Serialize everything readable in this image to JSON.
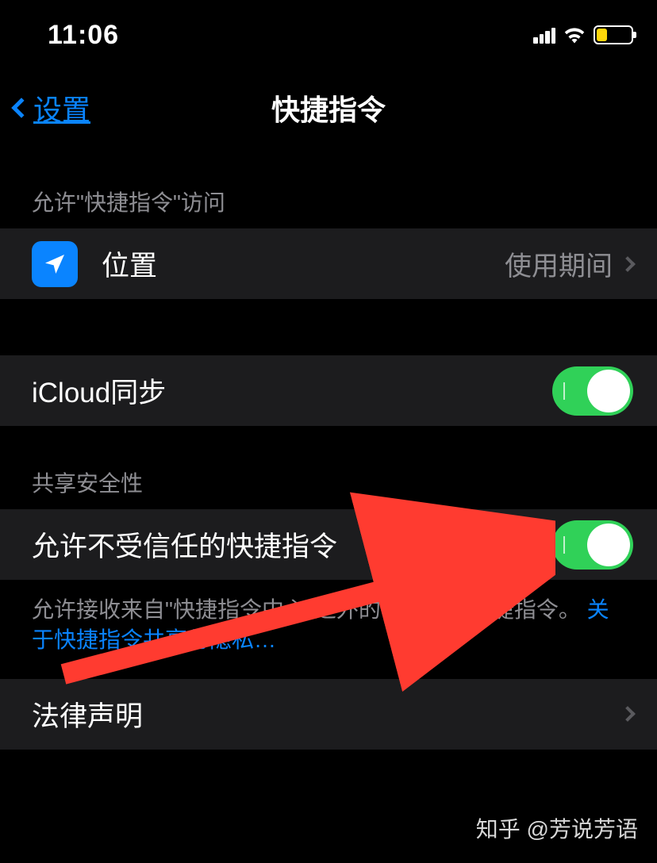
{
  "status": {
    "time": "11:06"
  },
  "nav": {
    "back_label": "设置",
    "title": "快捷指令"
  },
  "sections": {
    "access": {
      "header": "允许\"快捷指令\"访问",
      "location": {
        "label": "位置",
        "value": "使用期间"
      }
    },
    "icloud": {
      "label": "iCloud同步",
      "enabled": true
    },
    "sharing": {
      "header": "共享安全性",
      "untrusted": {
        "label": "允许不受信任的快捷指令",
        "enabled": true
      },
      "footer_text": "允许接收来自\"快捷指令中心\"之外的不受信任快捷指令。",
      "footer_link": "关于快捷指令共享与隐私…"
    },
    "legal": {
      "label": "法律声明"
    }
  },
  "watermark": "知乎 @芳说芳语"
}
